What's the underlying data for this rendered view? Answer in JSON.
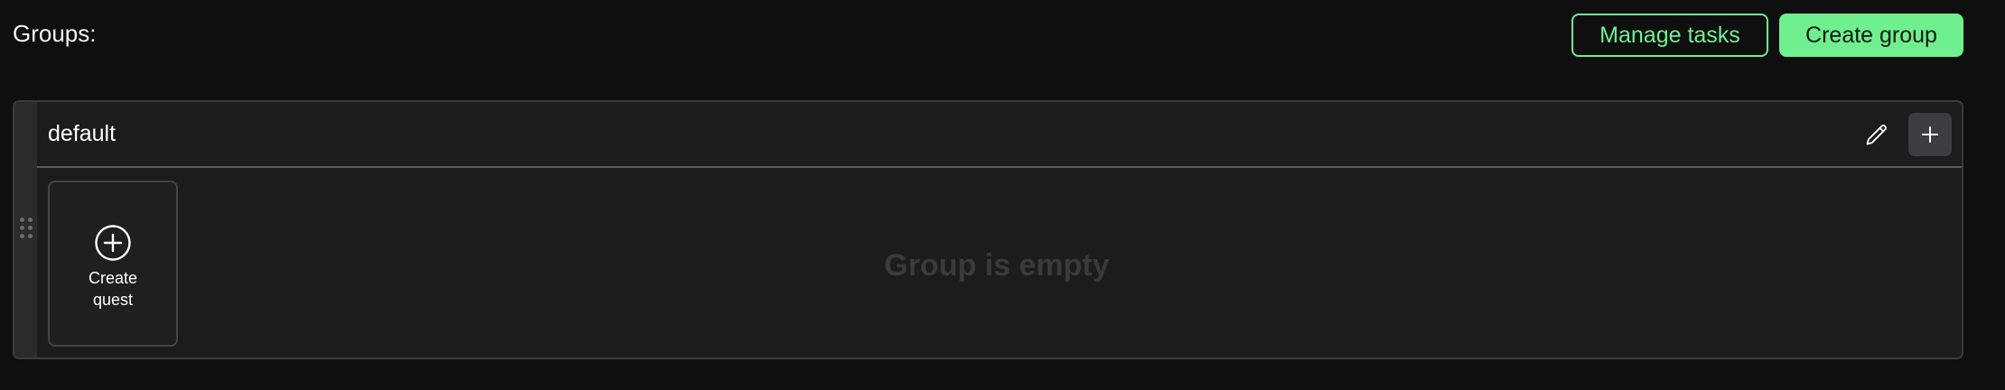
{
  "header": {
    "groups_label": "Groups:",
    "manage_tasks_label": "Manage tasks",
    "create_group_label": "Create group"
  },
  "group": {
    "title": "default",
    "create_quest_label": "Create quest",
    "empty_message": "Group is empty"
  },
  "icons": {
    "drag": "drag-handle-icon",
    "edit": "pencil-icon",
    "add": "plus-icon",
    "create_quest": "plus-circle-icon"
  },
  "colors": {
    "background": "#0f0f0f",
    "accent": "#6ef08f",
    "panel": "#1c1c1c",
    "muted_text": "#3a3a3a"
  }
}
